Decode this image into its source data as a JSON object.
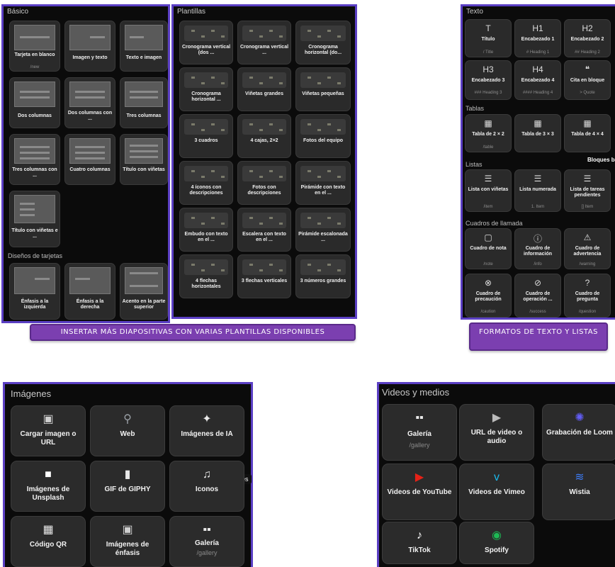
{
  "basico": {
    "title": "Básico",
    "tiles": [
      {
        "label": "Tarjeta en blanco",
        "sub": "/new"
      },
      {
        "label": "Imagen y texto",
        "sub": ""
      },
      {
        "label": "Texto e imagen",
        "sub": ""
      },
      {
        "label": "Dos columnas",
        "sub": ""
      },
      {
        "label": "Dos columnas con ...",
        "sub": ""
      },
      {
        "label": "Tres columnas",
        "sub": ""
      },
      {
        "label": "Tres columnas con ...",
        "sub": ""
      },
      {
        "label": "Cuatro columnas",
        "sub": ""
      },
      {
        "label": "Título con viñetas",
        "sub": ""
      },
      {
        "label": "Título con viñetas e ...",
        "sub": ""
      }
    ],
    "section2": "Diseños de tarjetas",
    "tiles2": [
      {
        "label": "Énfasis a la izquierda"
      },
      {
        "label": "Énfasis a la derecha"
      },
      {
        "label": "Acento en la parte superior"
      }
    ]
  },
  "plantillas": {
    "title": "Plantillas",
    "tiles": [
      {
        "label": "Cronograma vertical (dos ..."
      },
      {
        "label": "Cronograma vertical ..."
      },
      {
        "label": "Cronograma horizontal (do..."
      },
      {
        "label": "Cronograma horizontal ..."
      },
      {
        "label": "Viñetas grandes"
      },
      {
        "label": "Viñetas pequeñas"
      },
      {
        "label": "3 cuadros"
      },
      {
        "label": "4 cajas, 2×2"
      },
      {
        "label": "Fotos del equipo"
      },
      {
        "label": "4 íconos con descripciones"
      },
      {
        "label": "Fotos con descripciones"
      },
      {
        "label": "Pirámide con texto en el ..."
      },
      {
        "label": "Embudo con texto en el ..."
      },
      {
        "label": "Escalera con texto en el ..."
      },
      {
        "label": "Pirámide escalonada ..."
      },
      {
        "label": "4 flechas horizontales"
      },
      {
        "label": "3 flechas verticales"
      },
      {
        "label": "3 números grandes"
      }
    ]
  },
  "banner_left": "INSERTAR MÁS DIAPOSITIVAS CON VARIAS PLANTILLAS DISPONIBLES",
  "texto": {
    "title": "Texto",
    "tiles": [
      {
        "icon": "T",
        "label": "Título",
        "sub": "/ Title"
      },
      {
        "icon": "H1",
        "label": "Encabezado 1",
        "sub": "# Heading 1"
      },
      {
        "icon": "H2",
        "label": "Encabezado 2",
        "sub": "## Heading 2"
      },
      {
        "icon": "H3",
        "label": "Encabezado 3",
        "sub": "### Heading 3"
      },
      {
        "icon": "H4",
        "label": "Encabezado 4",
        "sub": "#### Heading 4"
      },
      {
        "icon": "❝",
        "label": "Cita en bloque",
        "sub": "> Quote"
      }
    ],
    "tablas_title": "Tablas",
    "tablas": [
      {
        "icon": "▦",
        "label": "Tabla de 2 × 2",
        "sub": "/table"
      },
      {
        "icon": "▦",
        "label": "Tabla de 3 × 3",
        "sub": ""
      },
      {
        "icon": "▦",
        "label": "Tabla de 4 × 4",
        "sub": ""
      }
    ],
    "listas_title": "Listas",
    "bloques_label": "Bloques bá",
    "listas": [
      {
        "icon": "☰",
        "label": "Lista con viñetas",
        "sub": "/item"
      },
      {
        "icon": "☰",
        "label": "Lista numerada",
        "sub": "1. Item"
      },
      {
        "icon": "☰",
        "label": "Lista de tareas pendientes",
        "sub": "[] Item"
      }
    ],
    "cuadros_title": "Cuadros de llamada",
    "cuadros": [
      {
        "icon": "▢",
        "label": "Cuadro de nota",
        "sub": "/note"
      },
      {
        "icon": "ⓘ",
        "label": "Cuadro de información",
        "sub": "/info"
      },
      {
        "icon": "⚠",
        "label": "Cuadro de advertencia",
        "sub": "/warning"
      },
      {
        "icon": "⊗",
        "label": "Cuadro de precaución",
        "sub": "/caution"
      },
      {
        "icon": "⊘",
        "label": "Cuadro de operación ...",
        "sub": "/success"
      },
      {
        "icon": "?",
        "label": "Cuadro de pregunta",
        "sub": "/question"
      }
    ]
  },
  "banner_right": "FORMATOS DE TEXTO Y LISTAS",
  "imagenes": {
    "title": "Imágenes",
    "tiles": [
      {
        "icon": "▣",
        "label": "Cargar imagen o URL",
        "sub": ""
      },
      {
        "icon": "⚲",
        "label": "Web",
        "sub": ""
      },
      {
        "icon": "✦",
        "label": "Imágenes de IA",
        "sub": ""
      },
      {
        "icon": "■",
        "label": "Imágenes de Unsplash",
        "sub": ""
      },
      {
        "icon": "▮",
        "label": "GIF de GIPHY",
        "sub": ""
      },
      {
        "icon": "♫",
        "label": "Iconos",
        "sub": ""
      },
      {
        "icon": "▦",
        "label": "Código QR",
        "sub": ""
      },
      {
        "icon": "▣",
        "label": "Imágenes de énfasis",
        "sub": ""
      },
      {
        "icon": "▪▪",
        "label": "Galería",
        "sub": "/gallery"
      }
    ],
    "tooltip": "Imágenes"
  },
  "videos": {
    "title": "Videos y medios",
    "tiles": [
      {
        "icon": "▪▪",
        "label": "Galería",
        "sub": "/gallery"
      },
      {
        "icon": "▶",
        "label": "URL de video o audio",
        "sub": ""
      },
      {
        "icon": "✺",
        "label": "Grabación de Loom",
        "sub": ""
      },
      {
        "icon": "▶",
        "label": "Videos de YouTube",
        "sub": ""
      },
      {
        "icon": "v",
        "label": "Videos de Vimeo",
        "sub": ""
      },
      {
        "icon": "≋",
        "label": "Wistia",
        "sub": ""
      },
      {
        "icon": "♪",
        "label": "TikTok",
        "sub": ""
      },
      {
        "icon": "◉",
        "label": "Spotify",
        "sub": ""
      }
    ]
  },
  "colors": {
    "border": "#5b3fc4",
    "banner": "#7b3fb0",
    "youtube": "#e62117",
    "vimeo": "#1ab7ea",
    "spotify": "#1db954",
    "loom": "#625df5",
    "wistia": "#3d7cf7"
  }
}
